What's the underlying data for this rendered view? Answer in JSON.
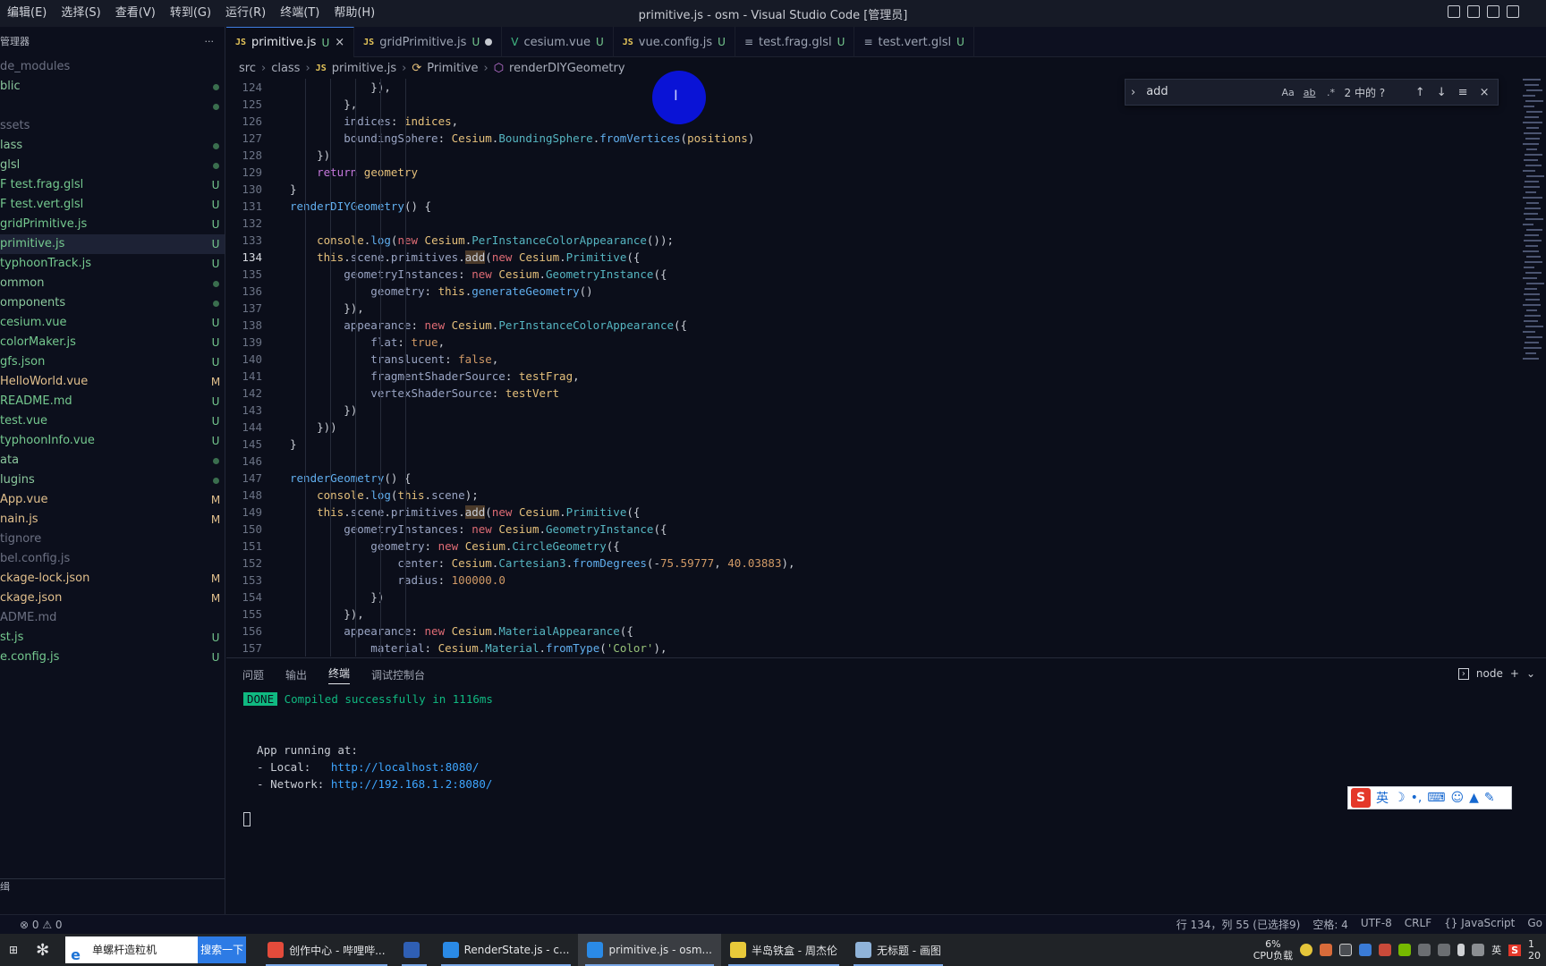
{
  "window": {
    "title": "primitive.js - osm - Visual Studio Code [管理员]"
  },
  "menu": [
    "编辑(E)",
    "选择(S)",
    "查看(V)",
    "转到(G)",
    "运行(R)",
    "终端(T)",
    "帮助(H)"
  ],
  "sidebar": {
    "header": "管理器",
    "more": "···",
    "items": [
      {
        "label": "de_modules",
        "status": "",
        "cls": "c-d"
      },
      {
        "label": "blic",
        "status": "dot",
        "cls": "c-g"
      },
      {
        "label": "",
        "status": "dot",
        "cls": "c-g"
      },
      {
        "label": "ssets",
        "status": "",
        "cls": "c-d"
      },
      {
        "label": "lass",
        "status": "dot",
        "cls": "c-g"
      },
      {
        "label": "glsl",
        "status": "dot",
        "cls": "c-g"
      },
      {
        "label": "F test.frag.glsl",
        "status": "U",
        "cls": "c-u"
      },
      {
        "label": "F test.vert.glsl",
        "status": "U",
        "cls": "c-u"
      },
      {
        "label": "gridPrimitive.js",
        "status": "U",
        "cls": "c-u"
      },
      {
        "label": "primitive.js",
        "status": "U",
        "cls": "c-u",
        "selected": true
      },
      {
        "label": "typhoonTrack.js",
        "status": "U",
        "cls": "c-u"
      },
      {
        "label": "ommon",
        "status": "dot",
        "cls": "c-g"
      },
      {
        "label": "omponents",
        "status": "dot",
        "cls": "c-g"
      },
      {
        "label": "cesium.vue",
        "status": "U",
        "cls": "c-u"
      },
      {
        "label": "colorMaker.js",
        "status": "U",
        "cls": "c-u"
      },
      {
        "label": "gfs.json",
        "status": "U",
        "cls": "c-u"
      },
      {
        "label": "HelloWorld.vue",
        "status": "M",
        "cls": "c-m"
      },
      {
        "label": "README.md",
        "status": "U",
        "cls": "c-u"
      },
      {
        "label": "test.vue",
        "status": "U",
        "cls": "c-u"
      },
      {
        "label": "typhoonInfo.vue",
        "status": "U",
        "cls": "c-u"
      },
      {
        "label": "ata",
        "status": "dot",
        "cls": "c-g"
      },
      {
        "label": "lugins",
        "status": "dot",
        "cls": "c-g"
      },
      {
        "label": "App.vue",
        "status": "M",
        "cls": "c-m"
      },
      {
        "label": "nain.js",
        "status": "M",
        "cls": "c-m"
      },
      {
        "label": "tignore",
        "status": "",
        "cls": "c-d"
      },
      {
        "label": "bel.config.js",
        "status": "",
        "cls": "c-d"
      },
      {
        "label": "ckage-lock.json",
        "status": "M",
        "cls": "c-m"
      },
      {
        "label": "ckage.json",
        "status": "M",
        "cls": "c-m"
      },
      {
        "label": "ADME.md",
        "status": "",
        "cls": "c-d"
      },
      {
        "label": "st.js",
        "status": "U",
        "cls": "c-u"
      },
      {
        "label": "e.config.js",
        "status": "U",
        "cls": "c-u"
      }
    ],
    "bottom_label": "缉"
  },
  "tabs": [
    {
      "icon": "JS",
      "kind": "js",
      "label": "primitive.js",
      "status": "U",
      "close": "×",
      "active": true
    },
    {
      "icon": "JS",
      "kind": "js",
      "label": "gridPrimitive.js",
      "status": "U",
      "close": "dot"
    },
    {
      "icon": "V",
      "kind": "vue",
      "label": "cesium.vue",
      "status": "U"
    },
    {
      "icon": "JS",
      "kind": "js",
      "label": "vue.config.js",
      "status": "U"
    },
    {
      "icon": "≡",
      "kind": "glsl",
      "label": "test.frag.glsl",
      "status": "U"
    },
    {
      "icon": "≡",
      "kind": "glsl",
      "label": "test.vert.glsl",
      "status": "U"
    }
  ],
  "breadcrumb": [
    "src",
    "class",
    "JS",
    "primitive.js",
    "Primitive",
    "renderDIYGeometry"
  ],
  "find": {
    "value": "add",
    "opt_case": "Aa",
    "opt_word": "ab",
    "opt_regex": ".*",
    "count": "2 中的 ?",
    "up": "↑",
    "down": "↓",
    "menu": "≡",
    "close": "×"
  },
  "editor": {
    "current_line": 134,
    "lines": [
      {
        "n": 124,
        "code": [
          [
            "pu",
            "            }),"
          ]
        ]
      },
      {
        "n": 125,
        "code": [
          [
            "pu",
            "        },"
          ]
        ]
      },
      {
        "n": 126,
        "code": [
          [
            "prop",
            "        indices"
          ],
          [
            "pu",
            ": "
          ],
          [
            "pr",
            "indices"
          ],
          [
            "pu",
            ","
          ]
        ]
      },
      {
        "n": 127,
        "code": [
          [
            "prop",
            "        boundingSphere"
          ],
          [
            "pu",
            ": "
          ],
          [
            "pr",
            "Cesium"
          ],
          [
            "pu",
            "."
          ],
          [
            "ty",
            "BoundingSphere"
          ],
          [
            "pu",
            "."
          ],
          [
            "fn",
            "fromVertices"
          ],
          [
            "pu",
            "("
          ],
          [
            "pr",
            "positions"
          ],
          [
            "pu",
            ")"
          ]
        ]
      },
      {
        "n": 128,
        "code": [
          [
            "pu",
            "    })"
          ]
        ]
      },
      {
        "n": 129,
        "code": [
          [
            "kw2",
            "    return "
          ],
          [
            "pr",
            "geometry"
          ]
        ]
      },
      {
        "n": 130,
        "code": [
          [
            "pu",
            "}"
          ]
        ]
      },
      {
        "n": 131,
        "code": [
          [
            "fn",
            "renderDIYGeometry"
          ],
          [
            "pu",
            "() {"
          ]
        ]
      },
      {
        "n": 132,
        "code": [
          [
            "pu",
            ""
          ]
        ]
      },
      {
        "n": 133,
        "code": [
          [
            "pr",
            "    console"
          ],
          [
            "pu",
            "."
          ],
          [
            "fn",
            "log"
          ],
          [
            "pu",
            "("
          ],
          [
            "kw",
            "new "
          ],
          [
            "pr",
            "Cesium"
          ],
          [
            "pu",
            "."
          ],
          [
            "ty",
            "PerInstanceColorAppearance"
          ],
          [
            "pu",
            "());"
          ]
        ]
      },
      {
        "n": 134,
        "code": [
          [
            "pr",
            "    this"
          ],
          [
            "pu",
            "."
          ],
          [
            "prop",
            "scene"
          ],
          [
            "pu",
            "."
          ],
          [
            "prop",
            "primitives"
          ],
          [
            "pu",
            "."
          ],
          [
            "hl",
            "add"
          ],
          [
            "pu",
            "("
          ],
          [
            "kw",
            "new "
          ],
          [
            "pr",
            "Cesium"
          ],
          [
            "pu",
            "."
          ],
          [
            "ty",
            "Primitive"
          ],
          [
            "pu",
            "({"
          ]
        ]
      },
      {
        "n": 135,
        "code": [
          [
            "prop",
            "        geometryInstances"
          ],
          [
            "pu",
            ": "
          ],
          [
            "kw",
            "new "
          ],
          [
            "pr",
            "Cesium"
          ],
          [
            "pu",
            "."
          ],
          [
            "ty",
            "GeometryInstance"
          ],
          [
            "pu",
            "({"
          ]
        ]
      },
      {
        "n": 136,
        "code": [
          [
            "prop",
            "            geometry"
          ],
          [
            "pu",
            ": "
          ],
          [
            "pr",
            "this"
          ],
          [
            "pu",
            "."
          ],
          [
            "fn",
            "generateGeometry"
          ],
          [
            "pu",
            "()"
          ]
        ]
      },
      {
        "n": 137,
        "code": [
          [
            "pu",
            "        }),"
          ]
        ]
      },
      {
        "n": 138,
        "code": [
          [
            "prop",
            "        appearance"
          ],
          [
            "pu",
            ": "
          ],
          [
            "kw",
            "new "
          ],
          [
            "pr",
            "Cesium"
          ],
          [
            "pu",
            "."
          ],
          [
            "ty",
            "PerInstanceColorAppearance"
          ],
          [
            "pu",
            "({"
          ]
        ]
      },
      {
        "n": 139,
        "code": [
          [
            "prop",
            "            flat"
          ],
          [
            "pu",
            ": "
          ],
          [
            "nb",
            "true"
          ],
          [
            "pu",
            ","
          ]
        ]
      },
      {
        "n": 140,
        "code": [
          [
            "prop",
            "            translucent"
          ],
          [
            "pu",
            ": "
          ],
          [
            "nb",
            "false"
          ],
          [
            "pu",
            ","
          ]
        ]
      },
      {
        "n": 141,
        "code": [
          [
            "prop",
            "            fragmentShaderSource"
          ],
          [
            "pu",
            ": "
          ],
          [
            "pr",
            "testFrag"
          ],
          [
            "pu",
            ","
          ]
        ]
      },
      {
        "n": 142,
        "code": [
          [
            "prop",
            "            vertexShaderSource"
          ],
          [
            "pu",
            ": "
          ],
          [
            "pr",
            "testVert"
          ]
        ]
      },
      {
        "n": 143,
        "code": [
          [
            "pu",
            "        })"
          ]
        ]
      },
      {
        "n": 144,
        "code": [
          [
            "pu",
            "    }))"
          ]
        ]
      },
      {
        "n": 145,
        "code": [
          [
            "pu",
            "}"
          ]
        ]
      },
      {
        "n": 146,
        "code": [
          [
            "pu",
            ""
          ]
        ]
      },
      {
        "n": 147,
        "code": [
          [
            "fn",
            "renderGeometry"
          ],
          [
            "pu",
            "() {"
          ]
        ]
      },
      {
        "n": 148,
        "code": [
          [
            "pr",
            "    console"
          ],
          [
            "pu",
            "."
          ],
          [
            "fn",
            "log"
          ],
          [
            "pu",
            "("
          ],
          [
            "pr",
            "this"
          ],
          [
            "pu",
            "."
          ],
          [
            "prop",
            "scene"
          ],
          [
            "pu",
            ");"
          ]
        ]
      },
      {
        "n": 149,
        "code": [
          [
            "pr",
            "    this"
          ],
          [
            "pu",
            "."
          ],
          [
            "prop",
            "scene"
          ],
          [
            "pu",
            "."
          ],
          [
            "prop",
            "primitives"
          ],
          [
            "pu",
            "."
          ],
          [
            "hl",
            "add"
          ],
          [
            "pu",
            "("
          ],
          [
            "kw",
            "new "
          ],
          [
            "pr",
            "Cesium"
          ],
          [
            "pu",
            "."
          ],
          [
            "ty",
            "Primitive"
          ],
          [
            "pu",
            "({"
          ]
        ]
      },
      {
        "n": 150,
        "code": [
          [
            "prop",
            "        geometryInstances"
          ],
          [
            "pu",
            ": "
          ],
          [
            "kw",
            "new "
          ],
          [
            "pr",
            "Cesium"
          ],
          [
            "pu",
            "."
          ],
          [
            "ty",
            "GeometryInstance"
          ],
          [
            "pu",
            "({"
          ]
        ]
      },
      {
        "n": 151,
        "code": [
          [
            "prop",
            "            geometry"
          ],
          [
            "pu",
            ": "
          ],
          [
            "kw",
            "new "
          ],
          [
            "pr",
            "Cesium"
          ],
          [
            "pu",
            "."
          ],
          [
            "ty",
            "CircleGeometry"
          ],
          [
            "pu",
            "({"
          ]
        ]
      },
      {
        "n": 152,
        "code": [
          [
            "prop",
            "                center"
          ],
          [
            "pu",
            ": "
          ],
          [
            "pr",
            "Cesium"
          ],
          [
            "pu",
            "."
          ],
          [
            "ty",
            "Cartesian3"
          ],
          [
            "pu",
            "."
          ],
          [
            "fn",
            "fromDegrees"
          ],
          [
            "pu",
            "(-"
          ],
          [
            "nb",
            "75.59777"
          ],
          [
            "pu",
            ", "
          ],
          [
            "nb",
            "40.03883"
          ],
          [
            "pu",
            "),"
          ]
        ]
      },
      {
        "n": 153,
        "code": [
          [
            "prop",
            "                radius"
          ],
          [
            "pu",
            ": "
          ],
          [
            "nb",
            "100000.0"
          ]
        ]
      },
      {
        "n": 154,
        "code": [
          [
            "pu",
            "            })"
          ]
        ]
      },
      {
        "n": 155,
        "code": [
          [
            "pu",
            "        }),"
          ]
        ]
      },
      {
        "n": 156,
        "code": [
          [
            "prop",
            "        appearance"
          ],
          [
            "pu",
            ": "
          ],
          [
            "kw",
            "new "
          ],
          [
            "pr",
            "Cesium"
          ],
          [
            "pu",
            "."
          ],
          [
            "ty",
            "MaterialAppearance"
          ],
          [
            "pu",
            "({"
          ]
        ]
      },
      {
        "n": 157,
        "code": [
          [
            "prop",
            "            material"
          ],
          [
            "pu",
            ": "
          ],
          [
            "pr",
            "Cesium"
          ],
          [
            "pu",
            "."
          ],
          [
            "ty",
            "Material"
          ],
          [
            "pu",
            "."
          ],
          [
            "fn",
            "fromType"
          ],
          [
            "pu",
            "("
          ],
          [
            "st2",
            "'Color'"
          ],
          [
            "pu",
            "),"
          ]
        ]
      }
    ]
  },
  "panel": {
    "tabs": [
      "问题",
      "输出",
      "终端",
      "调试控制台"
    ],
    "active_tab": "终端",
    "node_label": "node",
    "terminal": {
      "done_badge": "DONE",
      "done_text": " Compiled successfully in 1116ms",
      "running": "  App running at:",
      "local_label": "  - Local:   ",
      "local_url": "http://localhost:8080/",
      "network_label": "  - Network: ",
      "network_url": "http://192.168.1.2:8080/"
    }
  },
  "ime": {
    "lang": "英"
  },
  "statusbar": {
    "errors": "⊗ 0 ⚠ 0",
    "position": "行 134，列 55 (已选择9)",
    "spaces": "空格: 4",
    "encoding": "UTF-8",
    "eol": "CRLF",
    "language": "{} JavaScript",
    "go": "Go"
  },
  "taskbar": {
    "search_placeholder": "单螺杆造粒机",
    "search_button": "搜索一下",
    "apps": [
      {
        "label": "创作中心 - 哔哩哔...",
        "color": "#e34b3b"
      },
      {
        "label": "",
        "color": "#2f5fb4"
      },
      {
        "label": "RenderState.js - c...",
        "color": "#2a8ae6"
      },
      {
        "label": "primitive.js - osm...",
        "color": "#2a8ae6",
        "active": true
      },
      {
        "label": "半岛铁盒 - 周杰伦",
        "color": "#e8c93a"
      },
      {
        "label": "无标题 - 画图",
        "color": "#8fb3d9"
      }
    ],
    "cpu_pct": "6%",
    "cpu_label": "CPU负载",
    "lang": "英",
    "ime": "S",
    "time": "1",
    "date": "20"
  },
  "colors": {
    "accent": "#3f7de0",
    "untracked": "#75c98f",
    "modified": "#e2c08d",
    "done": "#10b981",
    "link": "#3ea6ff"
  }
}
